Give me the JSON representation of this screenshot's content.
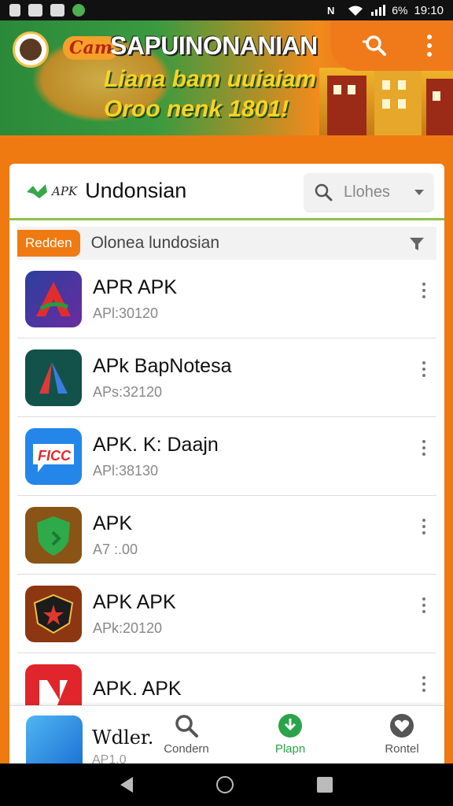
{
  "status_bar": {
    "time": "19:10",
    "battery": "6%"
  },
  "banner": {
    "cam_label": "Cam",
    "title": "SAPUINONANIAN",
    "line2": "Liana bam uuiaiam",
    "line3": "Oroo nenk 1801!"
  },
  "header": {
    "logo_text": "APK",
    "title": "Undonsian",
    "search_placeholder": "Llohes"
  },
  "filter": {
    "badge": "Redden",
    "text": "Olonea lundosian"
  },
  "apps": [
    {
      "name": "APR APK",
      "meta": "APl:30120",
      "icon": "apr-app-icon",
      "color": "#2b3f9e",
      "glyph": "A"
    },
    {
      "name": "APk BapNotesa",
      "meta": "APs:32120",
      "icon": "apk-bapnotesa-icon",
      "color": "#13524a",
      "glyph": "A"
    },
    {
      "name": "APK. K: Daajn",
      "meta": "APl:38130",
      "icon": "daajn-app-icon",
      "color": "#2486e8",
      "glyph": "FICC"
    },
    {
      "name": "APK",
      "meta": "A7 :.00",
      "icon": "shield-app-icon",
      "color": "#8a5417",
      "glyph": ""
    },
    {
      "name": "APK APK",
      "meta": "APk:20120",
      "icon": "badge-app-icon",
      "color": "#8c3712",
      "glyph": "★"
    },
    {
      "name": "APK. APK",
      "meta": "",
      "icon": "red-app-icon",
      "color": "#e0262c",
      "glyph": "N"
    }
  ],
  "bottom": {
    "peek_name": "Wdler.",
    "peek_meta": "AP1.0",
    "nav": [
      {
        "label": "Condern",
        "icon": "search-icon"
      },
      {
        "label": "Plapn",
        "icon": "download-icon"
      },
      {
        "label": "Rontel",
        "icon": "heart-icon"
      }
    ]
  },
  "colors": {
    "accent_orange": "#f07a12",
    "accent_green": "#2aa34a",
    "divider_green": "#8bc34a"
  }
}
